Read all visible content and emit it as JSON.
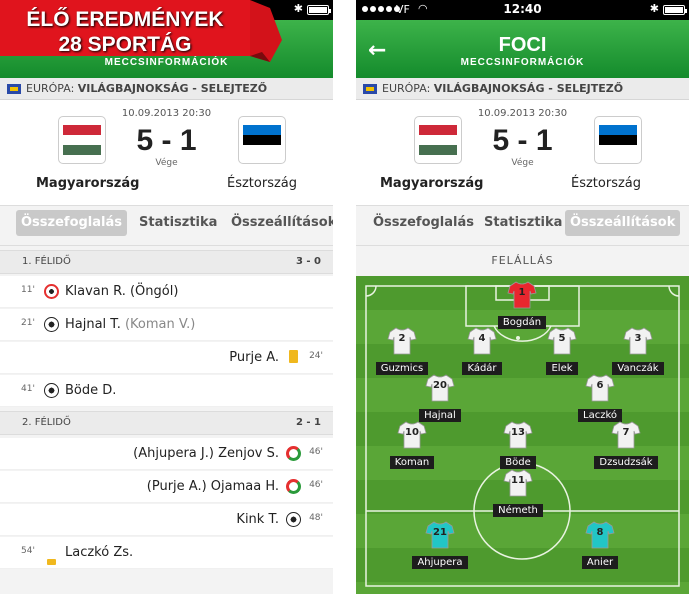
{
  "promo": {
    "line1": "ÉLŐ EREDMÉNYEK",
    "line2": "28 SPORTÁG"
  },
  "screen1": {
    "header_subtitle": "MECCSINFORMÁCIÓK",
    "competition_region": "EURÓPA:",
    "competition_name": "VILÁGBAJNOKSÁG - SELEJTEZŐ",
    "datetime": "10.09.2013 20:30",
    "score": "5 - 1",
    "status": "Vége",
    "home_team": "Magyarország",
    "away_team": "Észtország",
    "tabs": [
      "Összefoglalás",
      "Statisztika",
      "Összeállítások"
    ],
    "active_tab": "Összefoglalás",
    "sections": [
      {
        "label": "1. FÉLIDŐ",
        "score": "3 - 0"
      },
      {
        "label": "2. FÉLIDŐ",
        "score": "2 - 1"
      }
    ],
    "events": [
      {
        "minute": "11'",
        "side": "left",
        "type": "own-goal",
        "text": "Klavan R. (Öngól)",
        "sub": ""
      },
      {
        "minute": "21'",
        "side": "left",
        "type": "goal",
        "text": "Hajnal T.",
        "sub": "(Koman V.)"
      },
      {
        "minute": "24'",
        "side": "right",
        "type": "yellow-card",
        "text": "Purje A.",
        "sub": ""
      },
      {
        "minute": "41'",
        "side": "left",
        "type": "goal",
        "text": "Böde D.",
        "sub": ""
      },
      {
        "minute": "46'",
        "side": "right",
        "type": "substitution",
        "text": "(Ahjupera J.) Zenjov S.",
        "sub": ""
      },
      {
        "minute": "46'",
        "side": "right",
        "type": "substitution",
        "text": "(Purje A.) Ojamaa H.",
        "sub": ""
      },
      {
        "minute": "48'",
        "side": "right",
        "type": "goal",
        "text": "Kink T.",
        "sub": ""
      },
      {
        "minute": "54'",
        "side": "left",
        "type": "yellow-card",
        "text": "Laczkó Zs.",
        "sub": ""
      }
    ]
  },
  "screen2": {
    "status_bar": {
      "carrier": "VF",
      "time": "12:40"
    },
    "header_title": "FOCI",
    "header_subtitle": "MECCSINFORMÁCIÓK",
    "competition_region": "EURÓPA:",
    "competition_name": "VILÁGBAJNOKSÁG - SELEJTEZŐ",
    "datetime": "10.09.2013 20:30",
    "score": "5 - 1",
    "status": "Vége",
    "home_team": "Magyarország",
    "away_team": "Észtország",
    "tabs": [
      "Összefoglalás",
      "Statisztika",
      "Összeállítások"
    ],
    "active_tab": "Összeállítások",
    "formation_label": "FELÁLLÁS",
    "players": [
      {
        "number": "1",
        "name": "Bogdán",
        "kit": "goalkeeper"
      },
      {
        "number": "2",
        "name": "Guzmics",
        "kit": "outfield"
      },
      {
        "number": "4",
        "name": "Kádár",
        "kit": "outfield"
      },
      {
        "number": "5",
        "name": "Elek",
        "kit": "outfield"
      },
      {
        "number": "3",
        "name": "Vanczák",
        "kit": "outfield"
      },
      {
        "number": "20",
        "name": "Hajnal",
        "kit": "outfield"
      },
      {
        "number": "6",
        "name": "Laczkó",
        "kit": "outfield"
      },
      {
        "number": "10",
        "name": "Koman",
        "kit": "outfield"
      },
      {
        "number": "13",
        "name": "Böde",
        "kit": "outfield"
      },
      {
        "number": "7",
        "name": "Dzsudzsák",
        "kit": "outfield"
      },
      {
        "number": "11",
        "name": "Németh",
        "kit": "outfield"
      },
      {
        "number": "21",
        "name": "Ahjupera",
        "kit": "opponent"
      },
      {
        "number": "8",
        "name": "Anier",
        "kit": "opponent"
      }
    ]
  },
  "colors": {
    "header_green": "#1d9a35",
    "hungary": [
      "#ce2939",
      "#ffffff",
      "#477050"
    ],
    "estonia": [
      "#0072ce",
      "#000000",
      "#ffffff"
    ],
    "goalkeeper_kit": "#e8262e",
    "outfield_kit": "#f2f2f2",
    "opponent_kit": "#22c6c6",
    "yellow_card": "#f0b81e"
  }
}
